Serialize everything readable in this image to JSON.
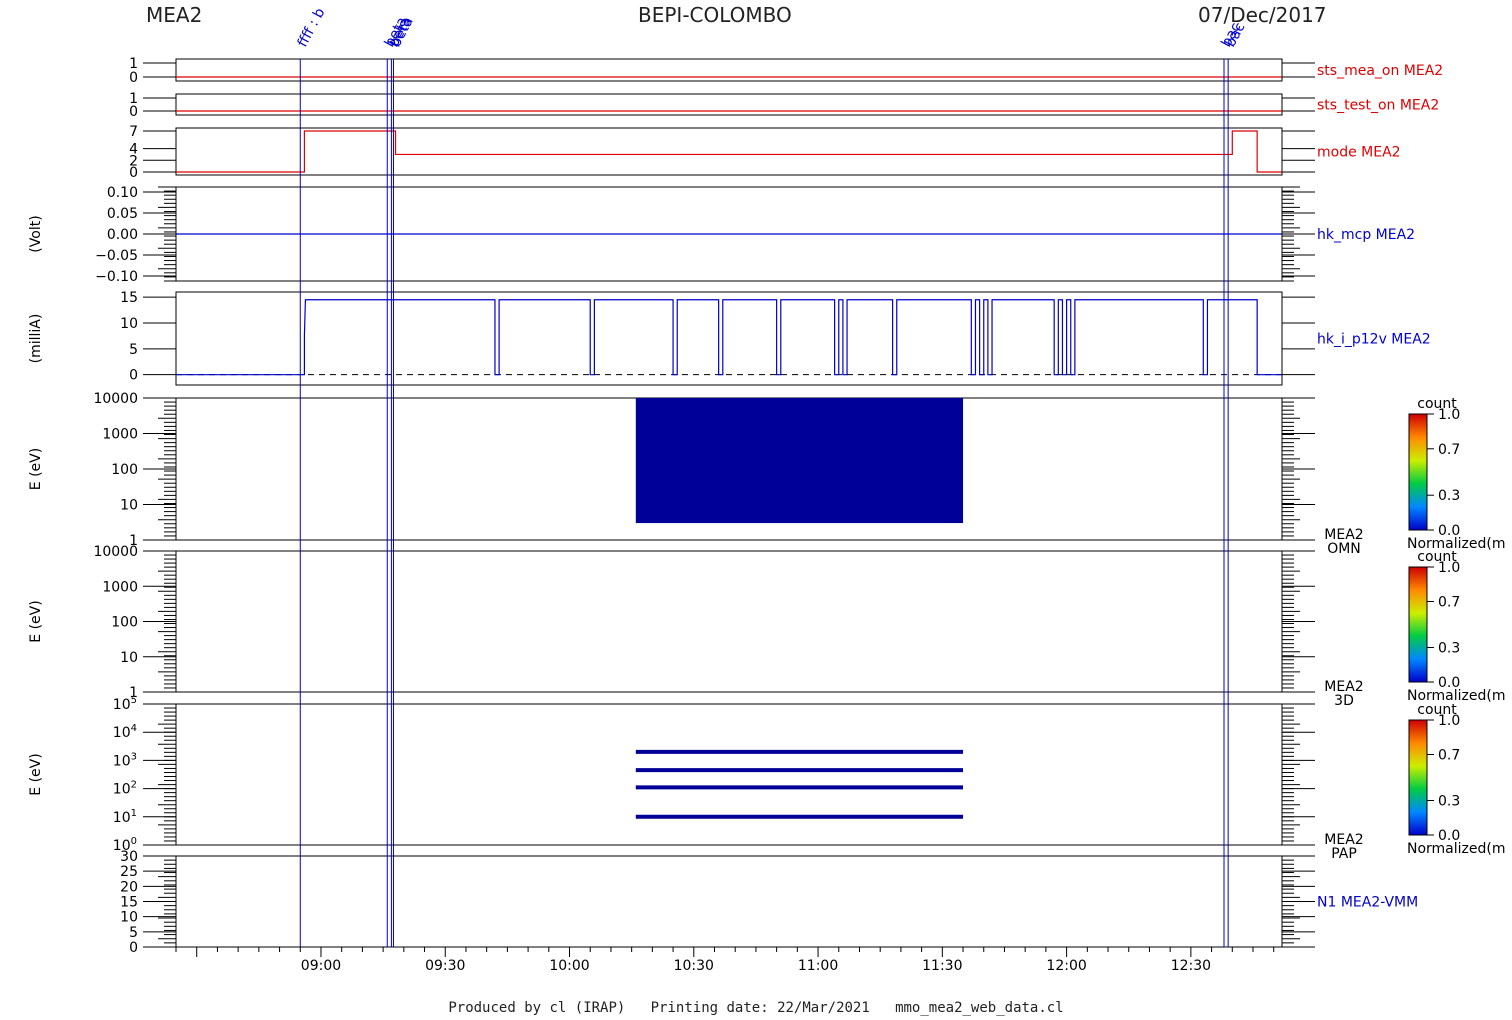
{
  "header": {
    "left": "MEA2",
    "center": "BEPI-COLOMBO",
    "right": "07/Dec/2017"
  },
  "footer": "Produced by cl (IRAP)   Printing date: 22/Mar/2021   mmo_mea2_web_data.cl",
  "colors": {
    "red": "#dd0000",
    "blue": "#0000cc",
    "fill": "#000099",
    "frame": "#000000"
  },
  "event_markers": [
    {
      "time": "08:55",
      "label": "ffff : b"
    },
    {
      "time": "09:16",
      "label": "beta"
    },
    {
      "time": "09:17",
      "label": "beta"
    },
    {
      "time": "09:17.5",
      "label": "beta"
    },
    {
      "time": "12:38",
      "label": "bac"
    },
    {
      "time": "12:39",
      "label": "bac"
    }
  ],
  "chart_data": [
    {
      "type": "line",
      "panel": "sts_mea_on",
      "series_name": "sts_mea_on MEA2",
      "color": "red",
      "ylim": [
        0,
        1
      ],
      "yticks": [
        "1",
        "0"
      ],
      "x": [
        "08:25",
        "12:52"
      ],
      "values": [
        0,
        0
      ]
    },
    {
      "type": "line",
      "panel": "sts_test_on",
      "series_name": "sts_test_on MEA2",
      "color": "red",
      "ylim": [
        0,
        1
      ],
      "yticks": [
        "1",
        "0"
      ],
      "x": [
        "08:25",
        "12:52"
      ],
      "values": [
        0,
        0
      ]
    },
    {
      "type": "line",
      "panel": "mode",
      "series_name": "mode MEA2",
      "color": "red",
      "ylim": [
        0,
        7
      ],
      "yticks": [
        "7",
        "4",
        "2",
        "0"
      ],
      "x": [
        "08:25",
        "08:56",
        "08:56",
        "09:18",
        "09:18",
        "12:40",
        "12:40",
        "12:46",
        "12:46",
        "12:52"
      ],
      "values": [
        0,
        0,
        7,
        7,
        3,
        3,
        7,
        7,
        0,
        0
      ]
    },
    {
      "type": "line",
      "panel": "hk_mcp",
      "series_name": "hk_mcp MEA2",
      "color": "blue",
      "ylabel": "(Volt)",
      "ylim": [
        -0.1,
        0.1
      ],
      "yticks": [
        "0.10",
        "0.05",
        "0.00",
        "−0.05",
        "−0.10"
      ],
      "x": [
        "08:25",
        "12:52"
      ],
      "values": [
        0,
        0
      ]
    },
    {
      "type": "line",
      "panel": "hk_i_p12v",
      "series_name": "hk_i_p12v MEA2",
      "color": "blue",
      "ylabel": "(milliA)",
      "ylim": [
        -2,
        16
      ],
      "yticks": [
        "15",
        "10",
        "5",
        "0"
      ],
      "dropouts": [
        [
          "09:42",
          "09:43"
        ],
        [
          "10:05",
          "10:06"
        ],
        [
          "10:25",
          "10:26"
        ],
        [
          "10:36",
          "10:37"
        ],
        [
          "10:50",
          "10:51"
        ],
        [
          "11:04",
          "11:05"
        ],
        [
          "11:06",
          "11:07"
        ],
        [
          "11:18",
          "11:19"
        ],
        [
          "11:37",
          "11:38"
        ],
        [
          "11:39",
          "11:40"
        ],
        [
          "11:41",
          "11:42"
        ],
        [
          "11:57",
          "11:58"
        ],
        [
          "11:59",
          "12:00"
        ],
        [
          "12:01",
          "12:02"
        ],
        [
          "12:33",
          "12:34"
        ]
      ],
      "level": 14.5,
      "on_start": "08:56",
      "on_end": "12:46"
    },
    {
      "type": "heatmap",
      "panel": "OMN",
      "name": "MEA2 OMN",
      "ylabel": "E (eV)",
      "ylim": [
        1,
        10000
      ],
      "yscale": "log",
      "yticks": [
        "10000",
        "1000",
        "100",
        "10",
        "1"
      ],
      "blocks": [
        {
          "x": [
            "10:16",
            "11:35"
          ],
          "y": [
            3,
            10000
          ]
        }
      ]
    },
    {
      "type": "heatmap",
      "panel": "3D",
      "name": "MEA2 3D",
      "ylabel": "E (eV)",
      "ylim": [
        1,
        10000
      ],
      "yscale": "log",
      "yticks": [
        "10000",
        "1000",
        "100",
        "10",
        "1"
      ],
      "blocks": []
    },
    {
      "type": "heatmap",
      "panel": "PAP",
      "name": "MEA2 PAP",
      "ylabel": "E (eV)",
      "ylim": [
        1,
        100000
      ],
      "yscale": "log",
      "yticks": [
        "10^5",
        "10^4",
        "10^3",
        "10^2",
        "10^1",
        "10^0"
      ],
      "bands": [
        {
          "x": [
            "10:16",
            "11:35"
          ],
          "y": [
            2000,
            450,
            110,
            10
          ]
        }
      ]
    },
    {
      "type": "line",
      "panel": "VMM",
      "series_name": "N1 MEA2-VMM",
      "color": "blue",
      "ylim": [
        0,
        30
      ],
      "yticks": [
        "30",
        "25",
        "20",
        "15",
        "10",
        "5",
        "0"
      ],
      "x": [],
      "values": []
    }
  ],
  "colorbars": [
    {
      "label_top": "count",
      "label_bottom": "Normalized(m",
      "ticks": [
        "1.0",
        "0.7",
        "0.3",
        "0.0"
      ]
    },
    {
      "label_top": "count",
      "label_bottom": "Normalized(m",
      "ticks": [
        "1.0",
        "0.7",
        "0.3",
        "0.0"
      ]
    },
    {
      "label_top": "count",
      "label_bottom": "Normalized(m",
      "ticks": [
        "1.0",
        "0.7",
        "0.3",
        "0.0"
      ]
    }
  ],
  "xaxis": {
    "xlim": [
      "08:25",
      "12:52"
    ],
    "tick_labels": [
      "09:00",
      "09:30",
      "10:00",
      "10:30",
      "11:00",
      "11:30",
      "12:00",
      "12:30"
    ]
  }
}
